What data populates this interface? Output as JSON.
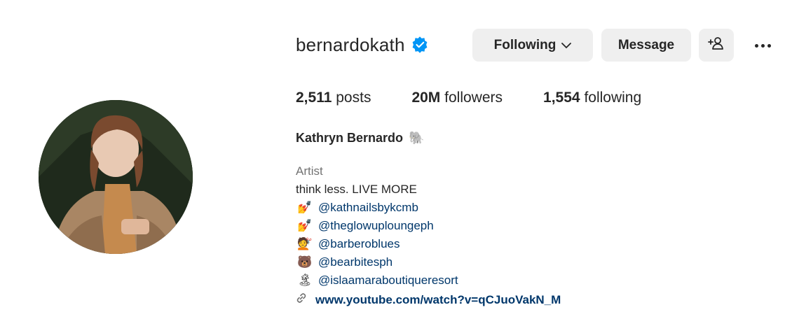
{
  "profile": {
    "username": "bernardokath",
    "verified": true,
    "full_name": "Kathryn Bernardo",
    "name_emoji": "🐘",
    "avatar_icon": "profile-photo"
  },
  "actions": {
    "following_label": "Following",
    "message_label": "Message",
    "add_user_icon": "person-add-icon",
    "more_icon": "more-options-icon"
  },
  "stats": {
    "posts_count": "2,511",
    "posts_label": "posts",
    "followers_count": "20M",
    "followers_label": "followers",
    "following_count": "1,554",
    "following_label": "following"
  },
  "bio": {
    "category": "Artist",
    "tagline": "think less. LIVE MORE",
    "mentions": [
      {
        "emoji": "💅",
        "handle": "@kathnailsbykcmb"
      },
      {
        "emoji": "💅",
        "handle": "@theglowuploungeph"
      },
      {
        "emoji": "💇",
        "handle": "@barberoblues"
      },
      {
        "emoji": "🐻",
        "handle": "@bearbitesph"
      },
      {
        "emoji": "🏝",
        "handle": "@islaamaraboutiqueresort"
      }
    ],
    "link": "www.youtube.com/watch?v=qCJuoVakN_M"
  },
  "colors": {
    "verified_blue": "#0095f6",
    "button_bg": "#efefef",
    "link_color": "#00376b",
    "muted_text": "#737373"
  }
}
